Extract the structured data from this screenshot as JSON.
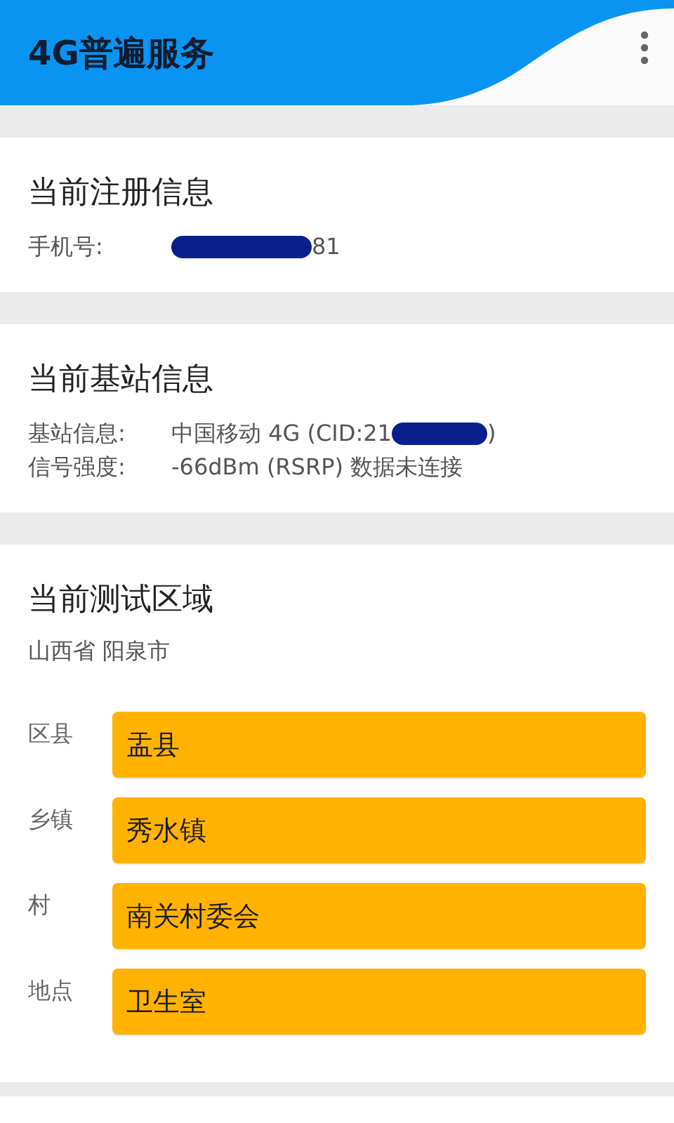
{
  "app_bar": {
    "title": "4G普遍服务"
  },
  "registration": {
    "title": "当前注册信息",
    "rows": [
      {
        "label": "手机号:",
        "parts": [
          {
            "kind": "redacted"
          },
          {
            "kind": "text",
            "text": "81"
          }
        ]
      }
    ]
  },
  "base_station": {
    "title": "当前基站信息",
    "rows": [
      {
        "label": "基站信息:",
        "parts": [
          {
            "kind": "text",
            "text": "中国移动 4G (CID:21"
          },
          {
            "kind": "redacted"
          },
          {
            "kind": "text",
            "text": ")"
          }
        ]
      },
      {
        "label": "信号强度:",
        "parts": [
          {
            "kind": "text",
            "text": "-66dBm (RSRP) 数据未连接"
          }
        ]
      }
    ]
  },
  "test_area": {
    "title": "当前测试区域",
    "region": "山西省 阳泉市",
    "fields": [
      {
        "label": "区县",
        "value": "盂县"
      },
      {
        "label": "乡镇",
        "value": "秀水镇"
      },
      {
        "label": "村",
        "value": "南关村委会"
      },
      {
        "label": "地点",
        "value": "卫生室"
      }
    ]
  }
}
